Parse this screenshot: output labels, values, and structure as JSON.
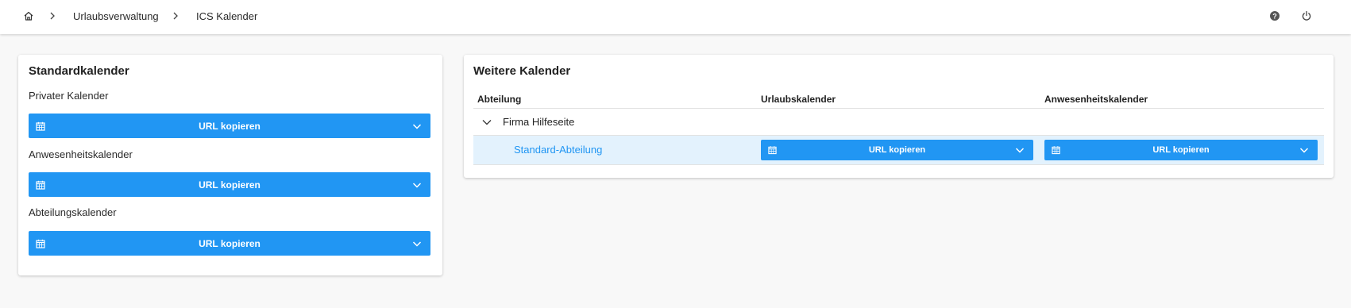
{
  "breadcrumb": {
    "home_icon": "home-icon",
    "items": [
      "Urlaubsverwaltung",
      "ICS Kalender"
    ]
  },
  "header_actions": {
    "help_icon": "help-icon",
    "power_icon": "power-icon"
  },
  "standard": {
    "title": "Standardkalender",
    "rows": [
      {
        "label": "Privater Kalender",
        "button": "URL kopieren"
      },
      {
        "label": "Anwesenheitskalender",
        "button": "URL kopieren"
      },
      {
        "label": "Abteilungskalender",
        "button": "URL kopieren"
      }
    ]
  },
  "further": {
    "title": "Weitere Kalender",
    "columns": [
      "Abteilung",
      "Urlaubskalender",
      "Anwesenheitskalender"
    ],
    "group": {
      "name": "Firma Hilfeseite",
      "expanded": true,
      "department": "Standard-Abteilung",
      "vacation_button": "URL kopieren",
      "presence_button": "URL kopieren"
    }
  },
  "colors": {
    "accent": "#2196f3",
    "row_highlight": "#e3f2fd",
    "link": "#2196f3"
  }
}
